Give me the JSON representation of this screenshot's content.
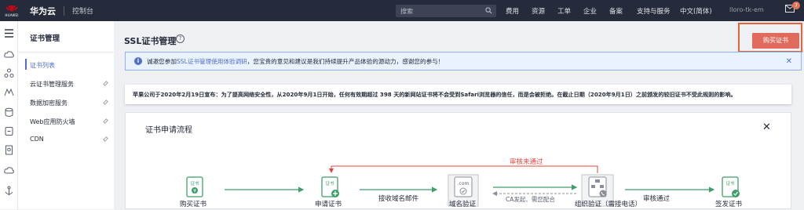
{
  "topbar": {
    "logo_text": "HUAWEI",
    "brand": "华为云",
    "console": "控制台",
    "search_placeholder": "搜索",
    "nav": [
      "费用",
      "资源",
      "工单",
      "企业",
      "备案",
      "支持与服务",
      "中文(简体)"
    ],
    "user": "lloro-tk-em",
    "mail_badge": "7"
  },
  "sidebar": {
    "title": "证书管理",
    "items": [
      {
        "label": "证书列表",
        "active": true
      },
      {
        "label": "云证书管理服务"
      },
      {
        "label": "数据加密服务"
      },
      {
        "label": "Web应用防火墙"
      },
      {
        "label": "CDN"
      }
    ]
  },
  "main": {
    "page_title": "SSL证书管理",
    "help": "?",
    "buy_button": "购买证书",
    "notice": {
      "prefix": "诚邀您参加",
      "link": "SSL证书管理使用体验调研",
      "suffix": "，您宝贵的意见和建议是我们持续提升产品体验的源动力，感谢您的参与！",
      "close": "✕"
    },
    "announcement": "苹果公司于2020年2月19日宣布：为了提高网络安全性，从2020年9月1日开始，任何有效期超过 398 天的新网站证书将不会受到Safari浏览器的信任，而是会被拒绝。在截止日期（2020年9月1日）之前颁发的较旧证书不受此规则的影响。",
    "flow": {
      "title": "证书申请流程",
      "close": "✕",
      "steps": [
        "购买证书",
        "申请证书",
        "域名验证",
        "组织验证（需接电话）",
        "签发证书"
      ],
      "edges": [
        "接收域名邮件",
        "CA发起、需您配合",
        "审核通过"
      ],
      "reject": "审核未通过",
      "icon_text": [
        "证书",
        "证书",
        ".com",
        "证书"
      ]
    }
  },
  "colors": {
    "accent": "#526ecc",
    "buy": "#e06b5c",
    "green": "#3f9e6b",
    "reject": "#e0443a"
  }
}
